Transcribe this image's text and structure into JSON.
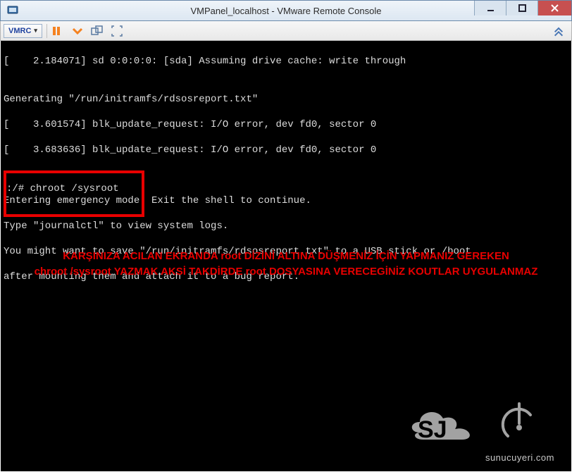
{
  "window": {
    "title": "VMPanel_localhost - VMware Remote Console"
  },
  "toolbar": {
    "vmrc_label": "VMRC"
  },
  "terminal": {
    "l1": "[    2.184071] sd 0:0:0:0: [sda] Assuming drive cache: write through",
    "l2": "",
    "l3": "Generating \"/run/initramfs/rdsosreport.txt\"",
    "l4": "[    3.601574] blk_update_request: I/O error, dev fd0, sector 0",
    "l5": "[    3.683636] blk_update_request: I/O error, dev fd0, sector 0",
    "l6": "",
    "l7": "",
    "l8": "Entering emergency mode. Exit the shell to continue.",
    "l9": "Type \"journalctl\" to view system logs.",
    "l10": "You might want to save \"/run/initramfs/rdsosreport.txt\" to a USB stick or /boot",
    "l11": "after mounting them and attach it to a bug report.",
    "prompt": ":/# chroot /sysroot"
  },
  "annotation": {
    "line1": "KARŞINIZA ACILAN EKRANDA root DİZİNİ ALTINA DÜŞMENİZ İÇİN YAPMANIZ GEREKEN",
    "line2": "chroot /sysroot YAZMAK AKSİ TAKDİRDE root DOSYASINA VERECEGİNİZ KOUTLAR UYGULANMAZ"
  },
  "logo": {
    "domain": "sunucuyeri.com"
  }
}
